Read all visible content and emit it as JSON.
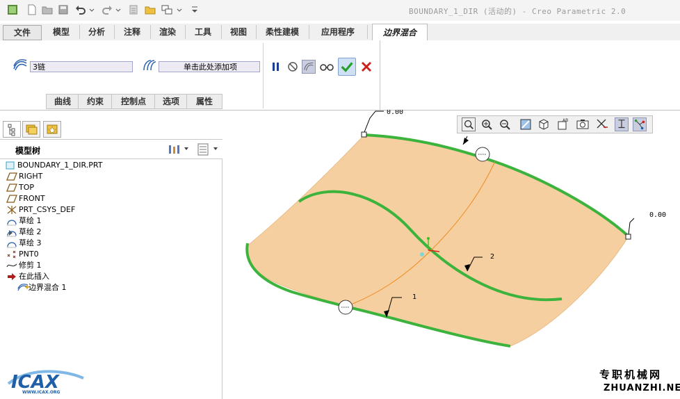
{
  "window": {
    "title": "BOUNDARY_1_DIR (活动的) - Creo Parametric 2.0"
  },
  "ribbon": {
    "file_tab": "文件",
    "tabs": [
      "模型",
      "分析",
      "注释",
      "渲染",
      "工具",
      "视图",
      "柔性建模",
      "应用程序"
    ],
    "active_tab": "边界混合"
  },
  "dashboard": {
    "first_direction_value": "3链",
    "second_direction_placeholder": "单击此处添加项",
    "subtabs": [
      "曲线",
      "约束",
      "控制点",
      "选项",
      "属性"
    ]
  },
  "model_tree": {
    "title": "模型树",
    "root": "BOUNDARY_1_DIR.PRT",
    "items": [
      {
        "label": "RIGHT",
        "icon": "datum-plane-icon"
      },
      {
        "label": "TOP",
        "icon": "datum-plane-icon"
      },
      {
        "label": "FRONT",
        "icon": "datum-plane-icon"
      },
      {
        "label": "PRT_CSYS_DEF",
        "icon": "csys-icon"
      },
      {
        "label": "草绘 1",
        "icon": "sketch-icon"
      },
      {
        "label": "草绘 2",
        "icon": "sketch-icon"
      },
      {
        "label": "草绘 3",
        "icon": "sketch-icon"
      },
      {
        "label": "PNT0",
        "icon": "datum-point-icon"
      },
      {
        "label": "修剪 1",
        "icon": "trim-icon"
      },
      {
        "label": "在此插入",
        "icon": "insert-arrow-icon"
      },
      {
        "label": "边界混合 1",
        "icon": "boundary-blend-icon"
      }
    ]
  },
  "viewport": {
    "annotations": {
      "label_top": "0.00",
      "label_right": "0.00",
      "label_1": "1",
      "label_2": "2"
    },
    "surface_color": "#f5cfa0",
    "curve_color": "#3cb33c",
    "internal_curve_color": "#ef8a1a"
  },
  "watermark": {
    "brand": "ICAX",
    "brand_url": "WWW.ICAX.ORG",
    "site_cn": "专职机械网",
    "site_en": "ZHUANZHI.NET"
  }
}
